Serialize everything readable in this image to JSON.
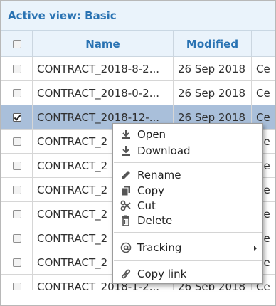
{
  "header": {
    "active_view": "Active view: Basic"
  },
  "table": {
    "columns": [
      "Name",
      "Modified",
      ""
    ],
    "rows": [
      {
        "name": "CONTRACT_2018-8-2...",
        "modified": "26 Sep 2018",
        "created": "Ce",
        "checked": false
      },
      {
        "name": "CONTRACT_2018-0-2...",
        "modified": "26 Sep 2018",
        "created": "Ce",
        "checked": false
      },
      {
        "name": "CONTRACT_2018-12-...",
        "modified": "26 Sep 2018",
        "created": "Ce",
        "checked": true
      },
      {
        "name": "CONTRACT_2",
        "modified": "",
        "created": "Ce",
        "checked": false
      },
      {
        "name": "CONTRACT_2",
        "modified": "",
        "created": "Ce",
        "checked": false
      },
      {
        "name": "CONTRACT_2",
        "modified": "",
        "created": "Ce",
        "checked": false
      },
      {
        "name": "CONTRACT_2",
        "modified": "",
        "created": "Ce",
        "checked": false
      },
      {
        "name": "CONTRACT_2",
        "modified": "",
        "created": "Ce",
        "checked": false
      },
      {
        "name": "CONTRACT_2",
        "modified": "",
        "created": "Ce",
        "checked": false
      },
      {
        "name": "CONTRACT_2018-1-2...",
        "modified": "26 Sep 2018",
        "created": "Ce",
        "checked": false
      }
    ]
  },
  "context_menu": {
    "open": "Open",
    "download": "Download",
    "rename": "Rename",
    "copy": "Copy",
    "cut": "Cut",
    "delete": "Delete",
    "tracking": "Tracking",
    "copy_link": "Copy link"
  },
  "colors": {
    "header_text": "#2a73b3",
    "header_bg": "#eaf3fb",
    "selected_row": "#a9bfda",
    "menu_icon": "#555555"
  },
  "icons": {
    "open": "download-arrow-icon",
    "download": "download-arrow-icon",
    "rename": "pencil-icon",
    "copy": "copy-icon",
    "cut": "scissors-icon",
    "delete": "trash-icon",
    "tracking": "at-sign-icon",
    "copy_link": "link-icon"
  }
}
